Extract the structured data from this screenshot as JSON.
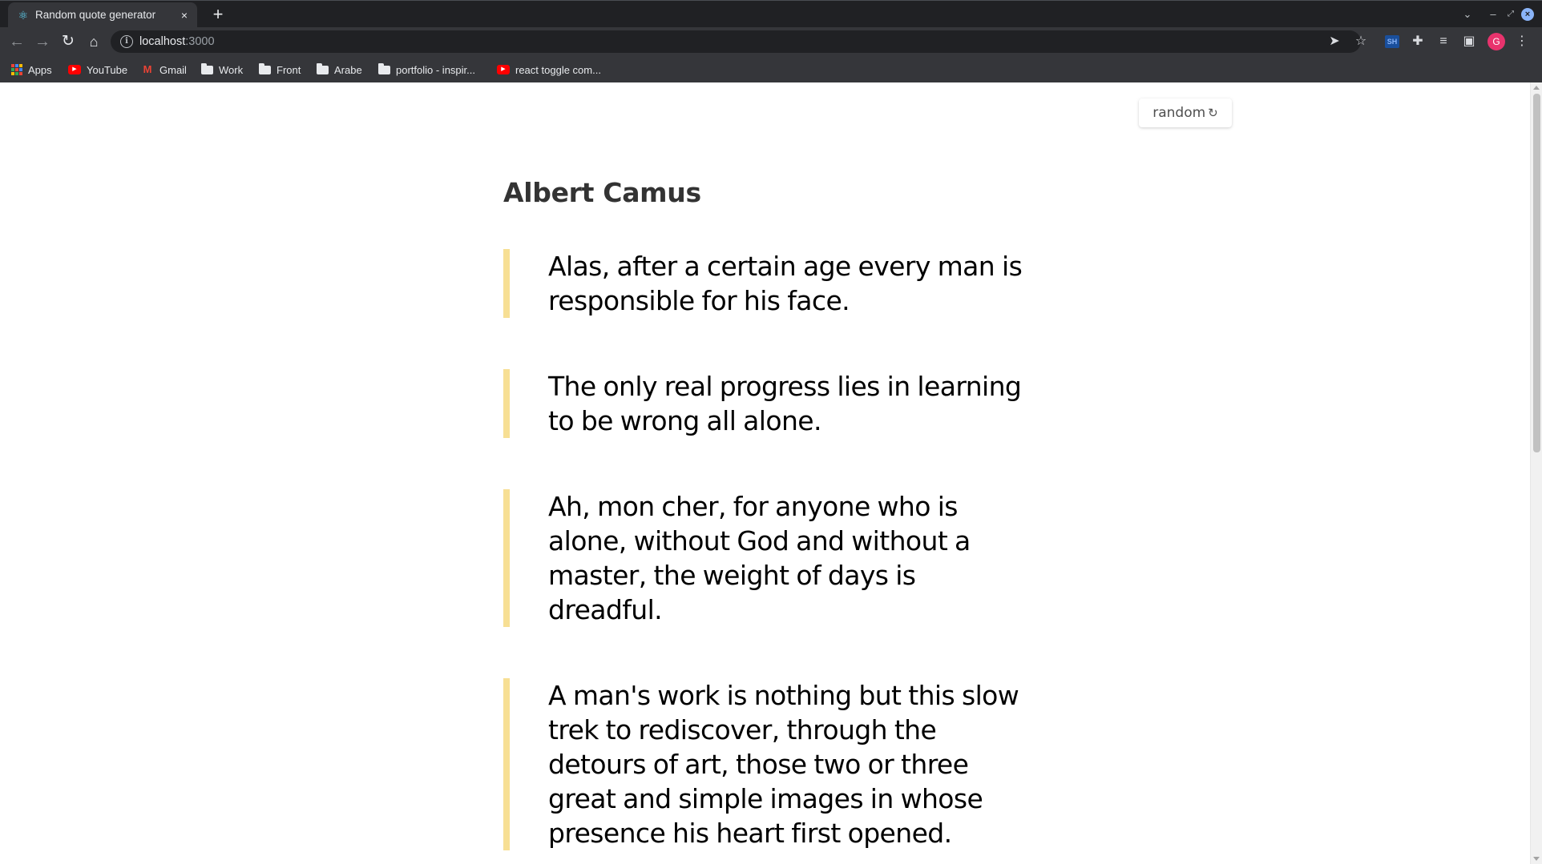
{
  "browser": {
    "tab_title": "Random quote generator",
    "new_tab": "+",
    "tab_close": "×",
    "url_host": "localhost",
    "url_port": ":3000",
    "avatar_letter": "G",
    "extension_label": "SH"
  },
  "bookmarks": [
    {
      "label": "Apps",
      "icon": "apps-icon"
    },
    {
      "label": "YouTube",
      "icon": "youtube-icon"
    },
    {
      "label": "Gmail",
      "icon": "gmail-icon"
    },
    {
      "label": "Work",
      "icon": "folder-icon"
    },
    {
      "label": "Front",
      "icon": "folder-icon"
    },
    {
      "label": "Arabe",
      "icon": "folder-icon"
    },
    {
      "label": "portfolio - inspir...",
      "icon": "folder-icon"
    },
    {
      "label": "react toggle com...",
      "icon": "youtube-icon"
    }
  ],
  "page": {
    "random_button_label": "random",
    "refresh_icon": "refresh-icon",
    "author": "Albert Camus",
    "accent_color": "#f7df94",
    "quotes": [
      {
        "text": "Alas, after a certain age every man is responsible for his face."
      },
      {
        "text": "The only real progress lies in learning to be wrong all alone."
      },
      {
        "text": "Ah, mon cher, for anyone who is alone, without God and without a master, the weight of days is dreadful."
      },
      {
        "text": "A man's work is nothing but this slow trek to rediscover, through the detours of art, those two or three great and simple images in whose presence his heart first opened."
      }
    ]
  }
}
